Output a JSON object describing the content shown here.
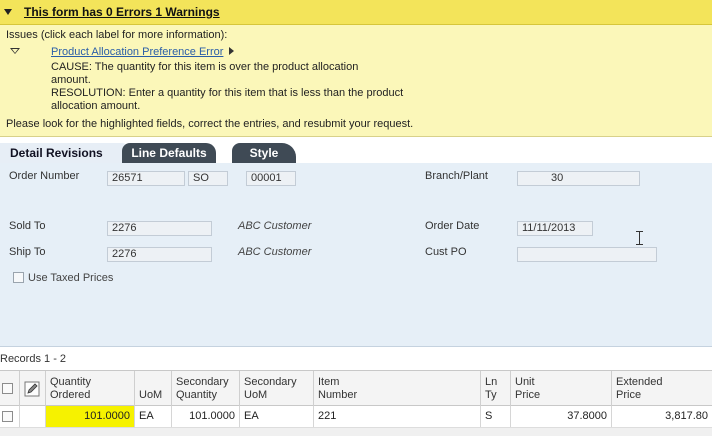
{
  "warning": {
    "title": "This form has 0 Errors 1 Warnings",
    "issues_intro": "Issues (click each label for more information):",
    "issue_label": "Product Allocation Preference Error",
    "cause": "CAUSE: The quantity for this item is over the product allocation amount.",
    "resolution": "RESOLUTION: Enter a quantity for this item that is less than the product allocation amount.",
    "footer": "Please look for the highlighted fields, correct the entries, and resubmit your request."
  },
  "tabs": [
    {
      "label": "Detail Revisions"
    },
    {
      "label": "Line Defaults"
    },
    {
      "label": "Style"
    }
  ],
  "form": {
    "order_number_label": "Order Number",
    "order_number": "26571",
    "order_type": "SO",
    "order_company": "00001",
    "branch_plant_label": "Branch/Plant",
    "branch_plant": "30",
    "sold_to_label": "Sold To",
    "sold_to": "2276",
    "sold_to_name": "ABC Customer",
    "order_date_label": "Order Date",
    "order_date": "11/11/2013",
    "ship_to_label": "Ship To",
    "ship_to": "2276",
    "ship_to_name": "ABC Customer",
    "cust_po_label": "Cust PO",
    "cust_po": "",
    "use_taxed_prices_label": "Use Taxed Prices"
  },
  "records": {
    "label": "Records 1 - 2"
  },
  "grid": {
    "columns": [
      {
        "line1": "Quantity",
        "line2": "Ordered"
      },
      {
        "line1": "UoM",
        "line2": ""
      },
      {
        "line1": "Secondary",
        "line2": "Quantity"
      },
      {
        "line1": "Secondary",
        "line2": "UoM"
      },
      {
        "line1": "Item",
        "line2": "Number"
      },
      {
        "line1": "Ln",
        "line2": "Ty"
      },
      {
        "line1": "Unit",
        "line2": "Price"
      },
      {
        "line1": "Extended",
        "line2": "Price"
      }
    ],
    "rows": [
      {
        "quantity_ordered": "101.0000",
        "uom": "EA",
        "secondary_quantity": "101.0000",
        "secondary_uom": "EA",
        "item_number": "221",
        "ln_ty": "S",
        "unit_price": "37.8000",
        "extended_price": "3,817.80"
      }
    ]
  },
  "colors": {
    "warning_header": "#f3e45a",
    "warning_body": "#fbf7b9",
    "highlight": "#f6f200",
    "tab_active_bg": "#e7eef6",
    "tab_inactive_bg": "#3f4a55",
    "form_bg": "#e6eff7"
  },
  "icons": {
    "collapse": "triangle-down-icon",
    "issue_expand": "triangle-right-icon",
    "grid_edit": "pencil-icon",
    "cursor": "text-cursor-icon"
  }
}
